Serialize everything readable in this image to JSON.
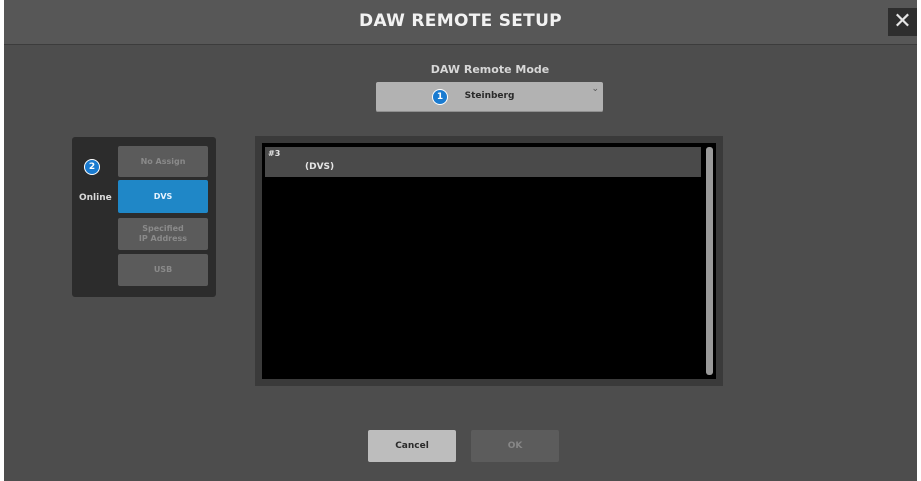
{
  "window": {
    "title": "DAW REMOTE SETUP",
    "close_glyph": "✕"
  },
  "mode": {
    "label": "DAW Remote Mode",
    "value": "Steinberg",
    "marker": "1"
  },
  "connection": {
    "marker": "2",
    "status_label": "Online",
    "options": [
      {
        "label": "No Assign",
        "active": false
      },
      {
        "label": "DVS",
        "active": true
      },
      {
        "label": "Specified\nIP Address",
        "active": false
      },
      {
        "label": "USB",
        "active": false
      }
    ]
  },
  "device_list": {
    "rows": [
      {
        "id": "#3",
        "name": "(DVS)"
      }
    ]
  },
  "footer": {
    "cancel_label": "Cancel",
    "ok_label": "OK"
  },
  "colors": {
    "accent": "#1f87c7",
    "marker": "#1a7bd0",
    "background": "#4d4d4d"
  },
  "icons": {
    "close": "close-icon",
    "dropdown": "chevron-down-icon"
  }
}
